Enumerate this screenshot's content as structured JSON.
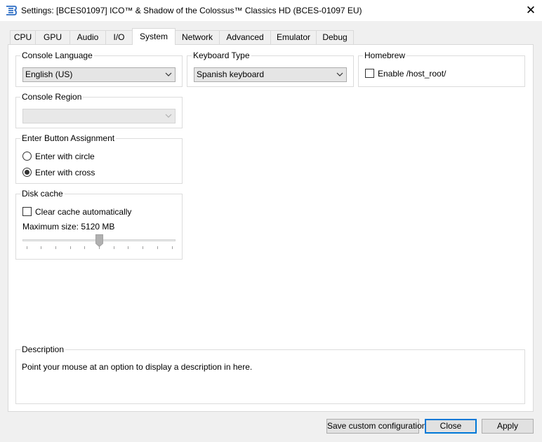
{
  "window": {
    "title": "Settings: [BCES01097] ICO™ & Shadow of the Colossus™ Classics HD (BCES-01097 EU)",
    "close_glyph": "✕",
    "app_icon": "rpcs3-icon"
  },
  "tabs": [
    {
      "label": "CPU"
    },
    {
      "label": "GPU"
    },
    {
      "label": "Audio"
    },
    {
      "label": "I/O"
    },
    {
      "label": "System",
      "active": true
    },
    {
      "label": "Network"
    },
    {
      "label": "Advanced"
    },
    {
      "label": "Emulator"
    },
    {
      "label": "Debug"
    }
  ],
  "system": {
    "console_language": {
      "label": "Console Language",
      "value": "English (US)"
    },
    "keyboard_type": {
      "label": "Keyboard Type",
      "value": "Spanish keyboard"
    },
    "homebrew": {
      "label": "Homebrew",
      "option": "Enable /host_root/",
      "checked": false
    },
    "console_region": {
      "label": "Console Region",
      "value": "",
      "disabled": true
    },
    "enter_button": {
      "label": "Enter Button Assignment",
      "options": [
        {
          "label": "Enter with circle",
          "selected": false
        },
        {
          "label": "Enter with cross",
          "selected": true
        }
      ]
    },
    "disk_cache": {
      "label": "Disk cache",
      "clear_label": "Clear cache automatically",
      "clear_checked": false,
      "max_size_text": "Maximum size: 5120 MB",
      "slider_fraction": 0.5
    }
  },
  "description": {
    "label": "Description",
    "text": "Point your mouse at an option to display a description in here."
  },
  "buttons": {
    "save": "Save custom configuration",
    "close": "Close",
    "apply": "Apply"
  },
  "colors": {
    "accent": "#0078d7",
    "panel_bg": "#ffffff",
    "window_bg": "#f0f0f0"
  }
}
